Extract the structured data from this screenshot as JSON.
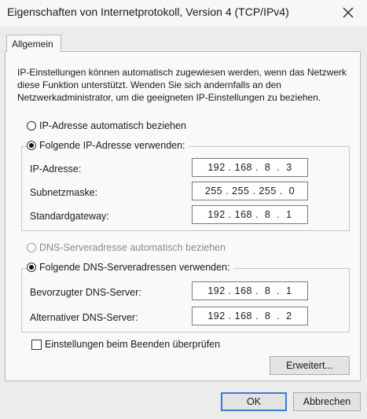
{
  "window": {
    "title": "Eigenschaften von Internetprotokoll, Version 4 (TCP/IPv4)"
  },
  "tab": {
    "label": "Allgemein"
  },
  "intro_text": "IP-Einstellungen können automatisch zugewiesen werden, wenn das Netzwerk diese Funktion unterstützt. Wenden Sie sich andernfalls an den Netzwerkadministrator, um die geeigneten IP-Einstellungen zu beziehen.",
  "ip": {
    "auto_label": "IP-Adresse automatisch beziehen",
    "auto_checked": false,
    "manual_label": "Folgende IP-Adresse verwenden:",
    "manual_checked": true,
    "address_label": "IP-Adresse:",
    "address_value": "192 . 168 .  8  .  3",
    "subnet_label": "Subnetzmaske:",
    "subnet_value": "255 . 255 . 255 .  0",
    "gateway_label": "Standardgateway:",
    "gateway_value": "192 . 168 .  8  .  1"
  },
  "dns": {
    "auto_label": "DNS-Serveradresse automatisch beziehen",
    "auto_checked": false,
    "manual_label": "Folgende DNS-Serveradressen verwenden:",
    "manual_checked": true,
    "preferred_label": "Bevorzugter DNS-Server:",
    "preferred_value": "192 . 168 .  8  .  1",
    "alternate_label": "Alternativer DNS-Server:",
    "alternate_value": "192 . 168 .  8  .  2"
  },
  "validate_label": "Einstellungen beim Beenden überprüfen",
  "validate_checked": false,
  "buttons": {
    "advanced": "Erweitert...",
    "ok": "OK",
    "cancel": "Abbrechen"
  },
  "colors": {
    "default_button_border": "#3a7bd5",
    "disabled_text": "#8a8a8a"
  },
  "icons": {
    "close": "close-icon"
  }
}
